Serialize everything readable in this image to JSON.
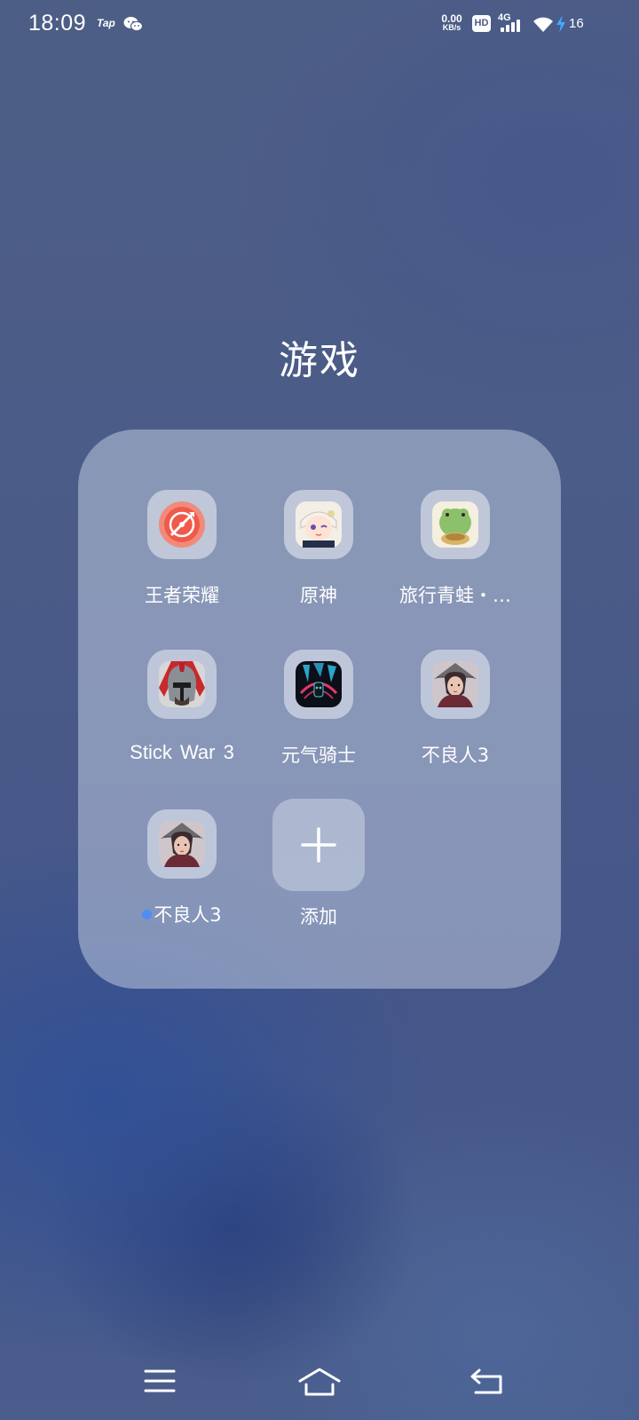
{
  "status_bar": {
    "time": "18:09",
    "notification_icons": [
      "tap-icon",
      "wechat-icon"
    ],
    "tap_label": "Tap",
    "net_speed_value": "0.00",
    "net_speed_unit": "KB/s",
    "hd_label": "HD",
    "network_type": "4G",
    "signal_level": 4,
    "wifi_icon": "wifi-icon",
    "charging_icon": "bolt-icon",
    "battery_level": "16"
  },
  "folder": {
    "title": "游戏",
    "apps": [
      {
        "label": "王者荣耀",
        "icon": "honor-of-kings-icon"
      },
      {
        "label": "原神",
        "icon": "genshin-impact-icon"
      },
      {
        "label": "旅行青蛙・…",
        "icon": "travel-frog-icon"
      },
      {
        "label": "Stick  War  3",
        "icon": "stick-war-icon"
      },
      {
        "label": "元气骑士",
        "icon": "soul-knight-icon"
      },
      {
        "label": "不良人3",
        "icon": "buliangren-icon"
      },
      {
        "label": "不良人3",
        "icon": "buliangren-icon",
        "new_indicator": true
      }
    ],
    "add_label": "添加"
  },
  "nav_bar": {
    "buttons": [
      "menu-icon",
      "home-icon",
      "back-icon"
    ]
  }
}
